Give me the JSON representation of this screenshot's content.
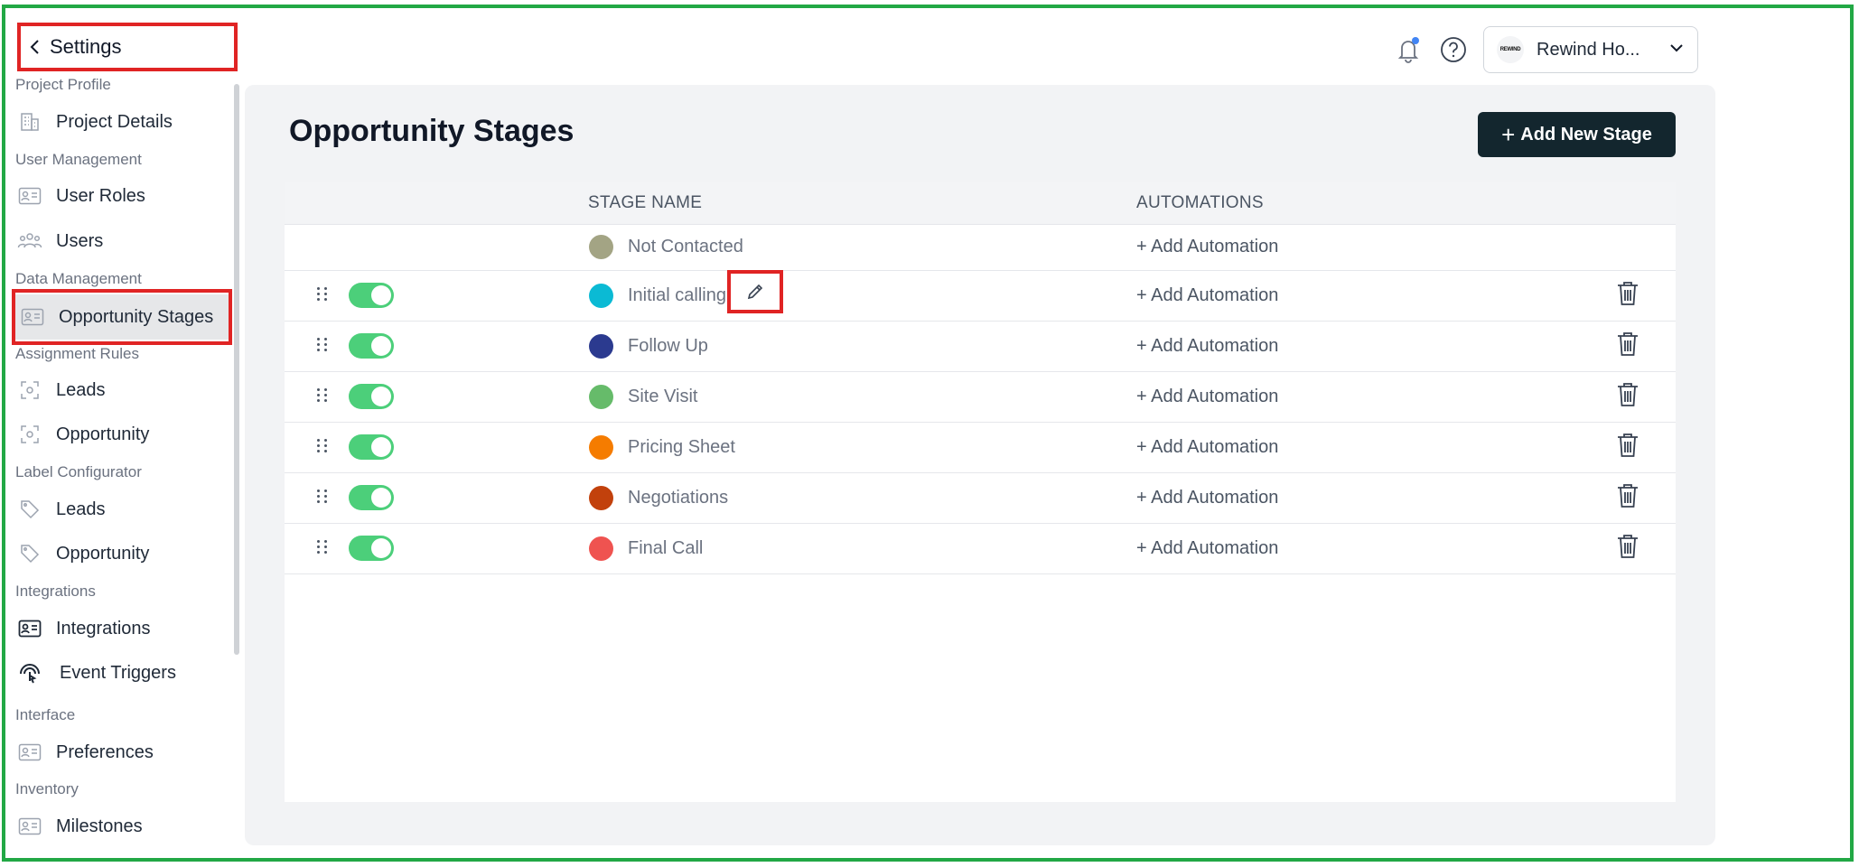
{
  "sidebar": {
    "back_label": "Settings",
    "sections": [
      {
        "title": "Project Profile",
        "items": [
          {
            "label": "Project Details",
            "icon": "building-icon"
          }
        ]
      },
      {
        "title": "User Management",
        "items": [
          {
            "label": "User Roles",
            "icon": "id-card-icon"
          },
          {
            "label": "Users",
            "icon": "users-icon"
          }
        ]
      },
      {
        "title": "Data Management",
        "items": [
          {
            "label": "Opportunity Stages",
            "icon": "id-card-icon",
            "active": true
          }
        ]
      },
      {
        "title": "Assignment Rules",
        "items": [
          {
            "label": "Leads",
            "icon": "focus-icon"
          },
          {
            "label": "Opportunity",
            "icon": "focus-icon"
          }
        ]
      },
      {
        "title": "Label Configurator",
        "items": [
          {
            "label": "Leads",
            "icon": "tag-icon"
          },
          {
            "label": "Opportunity",
            "icon": "tag-icon"
          }
        ]
      },
      {
        "title": "Integrations",
        "items": [
          {
            "label": "Integrations",
            "icon": "id-card-icon"
          },
          {
            "label": "Event Triggers",
            "icon": "touch-icon"
          }
        ]
      },
      {
        "title": "Interface",
        "items": [
          {
            "label": "Preferences",
            "icon": "id-card-icon"
          }
        ]
      },
      {
        "title": "Inventory",
        "items": [
          {
            "label": "Milestones",
            "icon": "id-card-icon"
          }
        ]
      }
    ]
  },
  "header": {
    "account_name": "Rewind Ho...",
    "avatar_text": "REWIND",
    "notification_dot_color": "#4285f4"
  },
  "main": {
    "title": "Opportunity Stages",
    "add_button_label": "Add New Stage",
    "columns": {
      "stage_name": "STAGE NAME",
      "automations": "AUTOMATIONS"
    },
    "add_automation_label": "+ Add Automation",
    "stages": [
      {
        "name": "Not Contacted",
        "color": "#a3a484",
        "enabled": null,
        "deletable": false
      },
      {
        "name": "Initial calling",
        "color": "#0bbad4",
        "enabled": true,
        "deletable": true,
        "editing": true
      },
      {
        "name": "Follow Up",
        "color": "#2b3a8f",
        "enabled": true,
        "deletable": true
      },
      {
        "name": "Site Visit",
        "color": "#66bb6a",
        "enabled": true,
        "deletable": true
      },
      {
        "name": "Pricing Sheet",
        "color": "#f57c00",
        "enabled": true,
        "deletable": true
      },
      {
        "name": "Negotiations",
        "color": "#c2410c",
        "enabled": true,
        "deletable": true
      },
      {
        "name": "Final Call",
        "color": "#ef5350",
        "enabled": true,
        "deletable": true
      }
    ]
  },
  "colors": {
    "accent_toggle": "#4ccf7a",
    "primary_button": "#13262e",
    "highlight_border": "#e02424",
    "frame_border": "#22a845"
  }
}
